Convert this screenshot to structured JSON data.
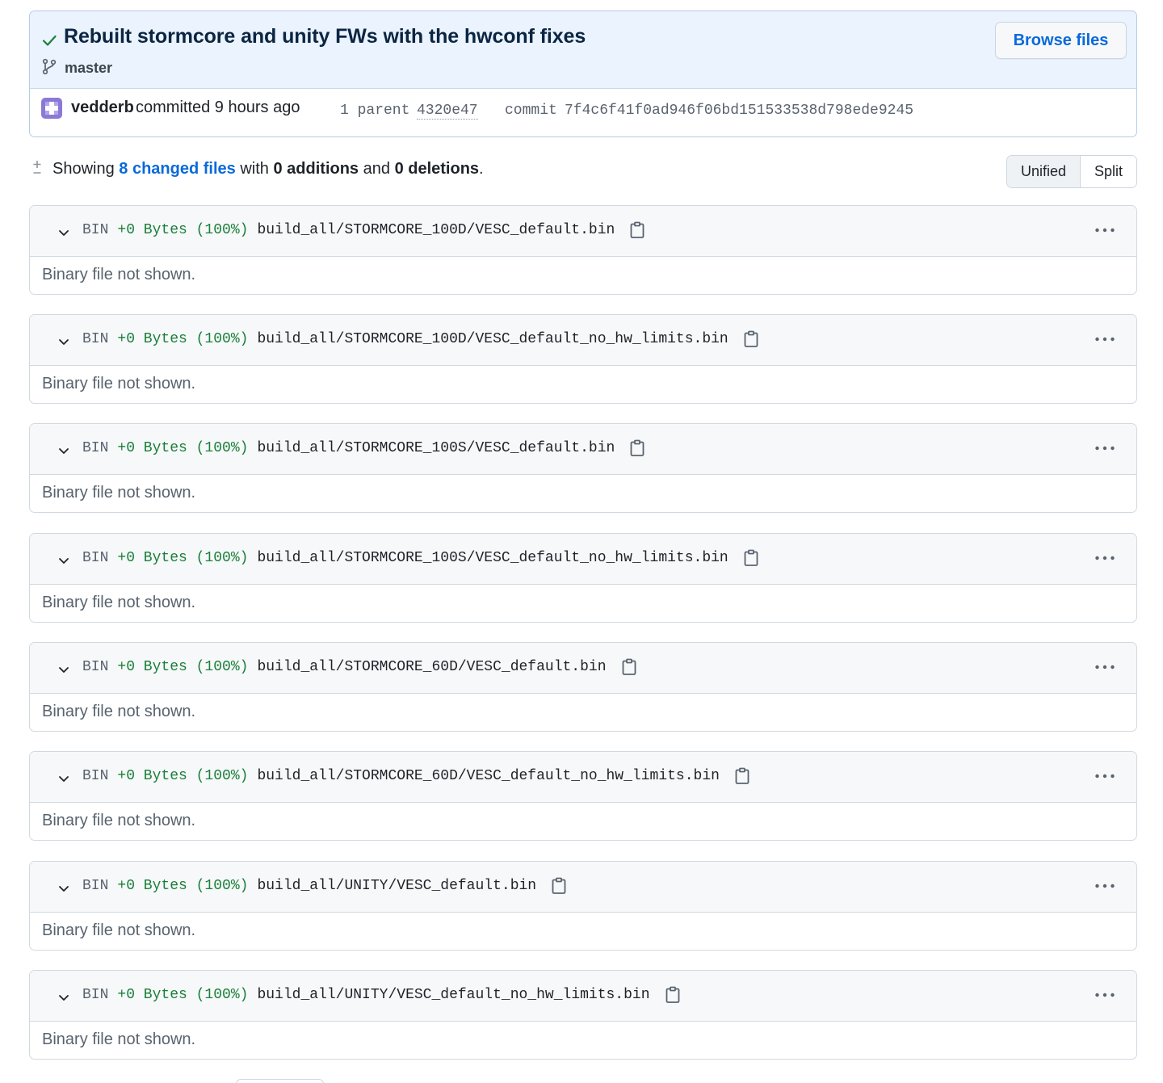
{
  "commit": {
    "title": "Rebuilt stormcore and unity FWs with the hwconf fixes",
    "branch": "master",
    "browse_files_label": "Browse files",
    "author": "vedderb",
    "committed_text": "committed 9 hours ago",
    "parent_label": "1 parent",
    "parent_sha": "4320e47",
    "commit_label": "commit",
    "commit_sha": "7f4c6f41f0ad946f06bd151533538d798ede9245",
    "status_color": "#1a7f37",
    "avatar_color": "#8b79d8"
  },
  "summary": {
    "showing": "Showing",
    "changed_files": "8 changed files",
    "with": "with",
    "additions": "0 additions",
    "and": "and",
    "deletions": "0 deletions",
    "period": "."
  },
  "view_toggle": {
    "unified": "Unified",
    "split": "Split",
    "selected": "Unified"
  },
  "files": [
    {
      "type": "BIN",
      "size": "+0 Bytes (100%)",
      "path": "build_all/STORMCORE_100D/VESC_default.bin",
      "body": "Binary file not shown."
    },
    {
      "type": "BIN",
      "size": "+0 Bytes (100%)",
      "path": "build_all/STORMCORE_100D/VESC_default_no_hw_limits.bin",
      "body": "Binary file not shown."
    },
    {
      "type": "BIN",
      "size": "+0 Bytes (100%)",
      "path": "build_all/STORMCORE_100S/VESC_default.bin",
      "body": "Binary file not shown."
    },
    {
      "type": "BIN",
      "size": "+0 Bytes (100%)",
      "path": "build_all/STORMCORE_100S/VESC_default_no_hw_limits.bin",
      "body": "Binary file not shown."
    },
    {
      "type": "BIN",
      "size": "+0 Bytes (100%)",
      "path": "build_all/STORMCORE_60D/VESC_default.bin",
      "body": "Binary file not shown."
    },
    {
      "type": "BIN",
      "size": "+0 Bytes (100%)",
      "path": "build_all/STORMCORE_60D/VESC_default_no_hw_limits.bin",
      "body": "Binary file not shown."
    },
    {
      "type": "BIN",
      "size": "+0 Bytes (100%)",
      "path": "build_all/UNITY/VESC_default.bin",
      "body": "Binary file not shown."
    },
    {
      "type": "BIN",
      "size": "+0 Bytes (100%)",
      "path": "build_all/UNITY/VESC_default_no_hw_limits.bin",
      "body": "Binary file not shown."
    }
  ],
  "icons": {
    "status": "check-icon",
    "branch": "git-branch-icon",
    "diffstat": "diff-icon",
    "expand": "chevron-down-icon",
    "copy": "clipboard-icon",
    "menu": "kebab-horizontal-icon"
  }
}
